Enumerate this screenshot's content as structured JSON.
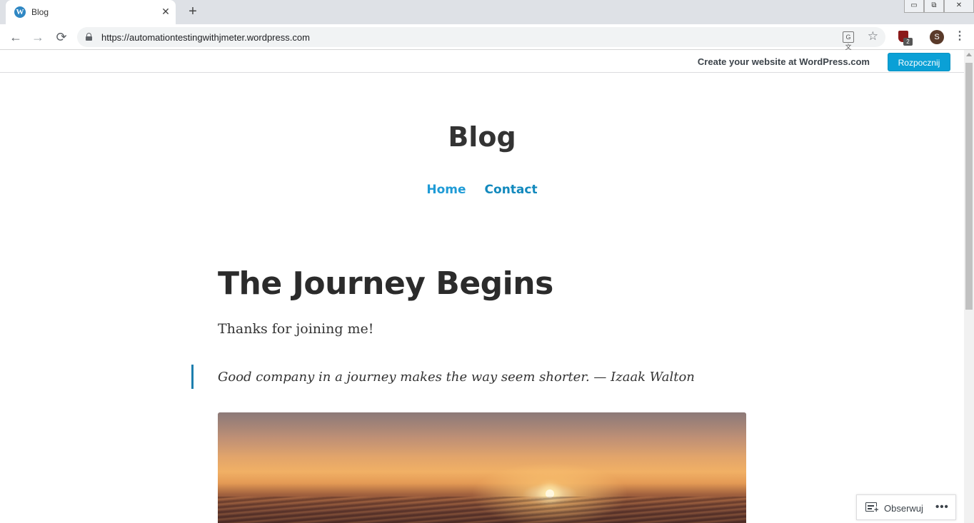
{
  "browser": {
    "tab": {
      "title": "Blog",
      "favicon": "wordpress-icon",
      "close_glyph": "✕"
    },
    "new_tab_glyph": "+",
    "window_controls": {
      "minimize": "▭",
      "restore": "⧉",
      "close": "✕"
    },
    "nav": {
      "back": "←",
      "forward": "→",
      "reload": "⟳"
    },
    "url": "https://automationtestingwithjmeter.wordpress.com",
    "translate_glyph": "G文",
    "star_glyph": "☆",
    "extension_badge": "2",
    "profile_initial": "S",
    "menu_glyph": "⋮"
  },
  "wp_bar": {
    "promo_text": "Create your website at WordPress.com",
    "button_label": "Rozpocznij"
  },
  "site": {
    "title": "Blog",
    "nav": [
      {
        "label": "Home"
      },
      {
        "label": "Contact"
      }
    ]
  },
  "post": {
    "title": "The Journey Begins",
    "intro": "Thanks for joining me!",
    "quote": "Good company in a journey makes the way seem shorter. — Izaak Walton"
  },
  "follow_widget": {
    "label": "Obserwuj",
    "more_glyph": "•••"
  },
  "colors": {
    "link": "#1289bd",
    "button": "#0aa0d6",
    "quote_border": "#1d7fae",
    "text": "#333333"
  }
}
